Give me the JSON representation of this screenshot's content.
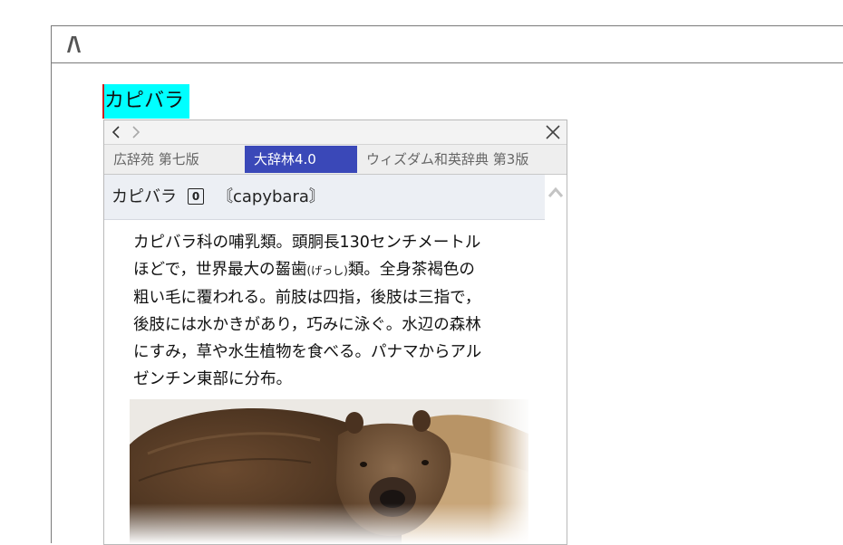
{
  "app": {
    "logo_icon": "app-logo-icon"
  },
  "selected_word": "カピバラ",
  "popup": {
    "nav": {
      "back_icon": "chevron-left-icon",
      "forward_icon": "chevron-right-icon",
      "close_label": "✕"
    },
    "tabs": [
      {
        "label": "広辞苑 第七版",
        "active": false
      },
      {
        "label": "大辞林4.0",
        "active": true
      },
      {
        "label": "ウィズダム和英辞典 第3版",
        "active": false
      }
    ],
    "entry": {
      "headword": "カピバラ",
      "accent": "0",
      "origin": "〘capybara〙"
    },
    "definition": {
      "lines": [
        "カピバラ科の哺乳類。頭胴長130センチメートル",
        "ほどで，世界最大の齧歯",
        "類。全身茶褐色の",
        "粗い毛に覆われる。前肢は四指，後肢は三指で，",
        "後肢には水かきがあり，巧みに泳ぐ。水辺の森林",
        "にすみ，草や水生植物を食べる。パナマからアル",
        "ゼンチン東部に分布。"
      ],
      "ruby": "(げっし)"
    },
    "image": {
      "subject": "capybara photo"
    }
  },
  "colors": {
    "highlight": "#00ffff",
    "active_tab": "#3a48b8",
    "header_bg": "#eceff4"
  }
}
